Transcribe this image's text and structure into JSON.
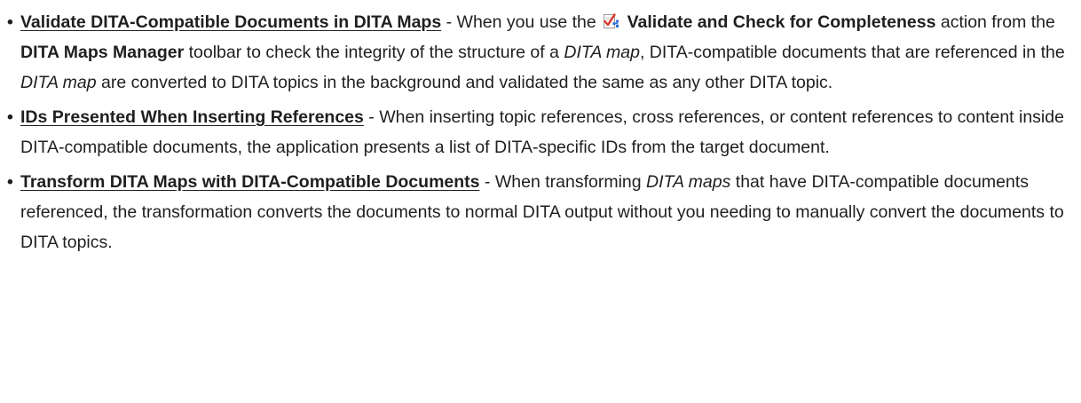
{
  "items": [
    {
      "title": "Validate DITA-Compatible Documents in DITA Maps",
      "sep": " - ",
      "t1": "When you use the ",
      "action": "Validate and Check for Completeness",
      "t2": " action from the ",
      "manager": "DITA Maps Manager",
      "t3": " toolbar to check the integrity of the structure of a ",
      "em1": "DITA map",
      "t4": ", DITA-compatible documents that are referenced in the ",
      "em2": "DITA map",
      "t5": " are converted to DITA topics in the background and validated the same as any other DITA topic."
    },
    {
      "title": "IDs Presented When Inserting References",
      "sep": " - ",
      "t1": "When inserting topic references, cross references, or content references to content inside DITA-compatible documents, the application presents a list of DITA-specific IDs from the target document."
    },
    {
      "title": "Transform DITA Maps with DITA-Compatible Documents",
      "sep": " - ",
      "t1": "When transforming ",
      "em1": "DITA maps",
      "t2": " that have DITA-compatible documents referenced, the transformation converts the documents to normal DITA output without you needing to manually convert the documents to DITA topics."
    }
  ],
  "icons": {
    "validate": "validate-check-icon"
  },
  "colors": {
    "text": "#1f1f1f",
    "checkmark": "#d9342b",
    "map_icon": "#2f6fd6"
  }
}
